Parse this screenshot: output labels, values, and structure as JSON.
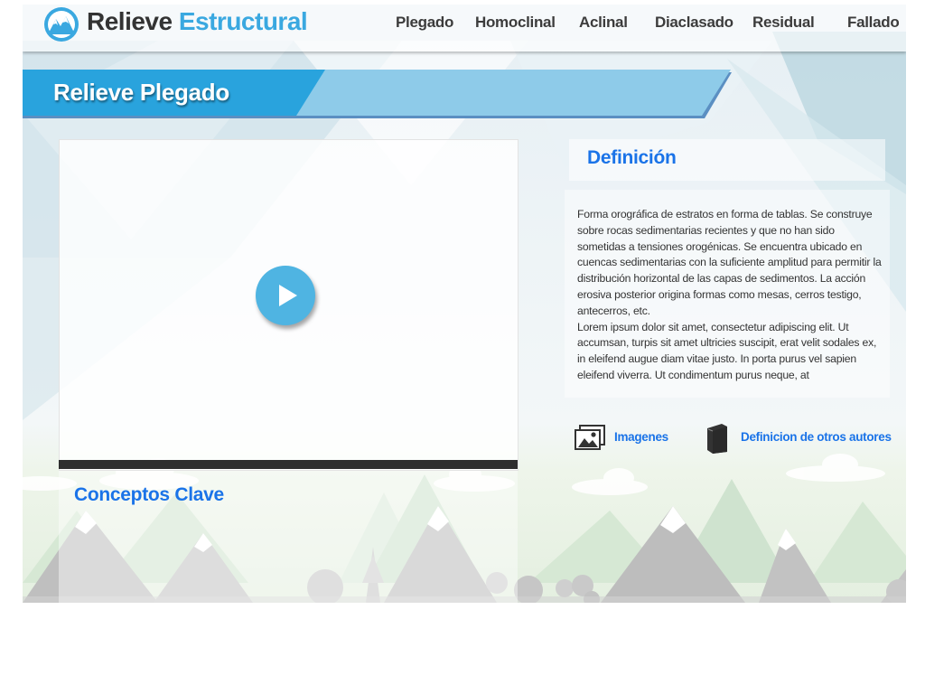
{
  "brand": {
    "name_part1": "Relieve",
    "name_part2": "Estructural",
    "icon": "mountain-logo-icon",
    "accent_color": "#3aa8e0"
  },
  "nav": {
    "items": [
      "Plegado",
      "Homoclinal",
      "Aclinal",
      "Diaclasado",
      "Residual",
      "Fallado"
    ]
  },
  "page": {
    "title": "Relieve Plegado"
  },
  "video": {
    "play_icon": "play-icon"
  },
  "definition": {
    "title": "Definición",
    "paragraphs": [
      "Forma orográfica de estratos en forma de tablas. Se construye sobre rocas sedimentarias recientes y que no han sido sometidas a tensiones orogénicas. Se encuentra ubicado en cuencas sedimentarias con la suficiente amplitud para permitir la distribución horizontal de las capas de sedimentos. La acción erosiva posterior origina formas como mesas, cerros testigo, antecerros, etc.",
      "Lorem ipsum dolor sit amet, consectetur adipiscing elit. Ut accumsan, turpis sit amet ultricies suscipit, erat velit sodales ex, in eleifend augue diam vitae justo. In porta purus vel sapien eleifend viverra. Ut condimentum purus neque, at"
    ]
  },
  "links": {
    "images": {
      "label": "Imagenes",
      "icon": "images-icon"
    },
    "authors": {
      "label": "Definicion de otros autores",
      "icon": "book-icon"
    }
  },
  "concepts": {
    "title": "Conceptos Clave"
  },
  "colors": {
    "link_blue": "#1a73e8",
    "banner_dark": "#29a3dd",
    "banner_light": "#8ecbe9"
  }
}
